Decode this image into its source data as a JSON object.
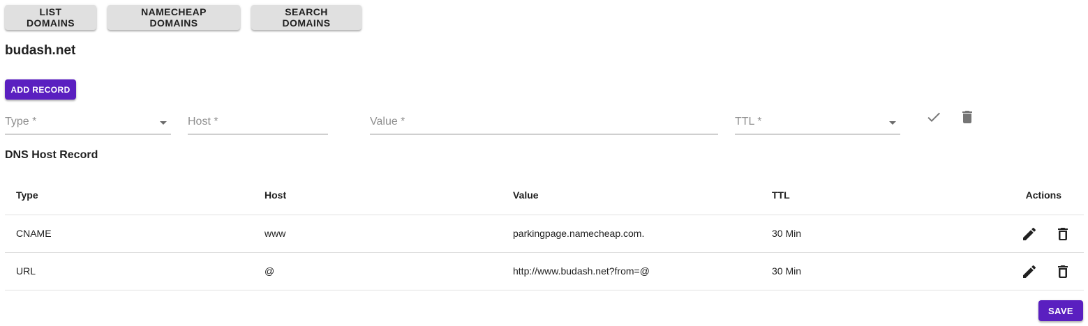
{
  "nav": {
    "list_domains": "LIST DOMAINS",
    "namecheap_domains": "NAMECHEAP DOMAINS",
    "search_domains": "SEARCH DOMAINS"
  },
  "domain": {
    "name": "budash.net"
  },
  "actions": {
    "add_record": "ADD RECORD",
    "save": "SAVE"
  },
  "form": {
    "type_label": "Type *",
    "host_label": "Host *",
    "value_label": "Value *",
    "ttl_label": "TTL *",
    "confirm_icon": "check-icon",
    "delete_icon": "trash-icon"
  },
  "section": {
    "title": "DNS Host Record"
  },
  "table": {
    "headers": {
      "type": "Type",
      "host": "Host",
      "value": "Value",
      "ttl": "TTL",
      "actions": "Actions"
    },
    "rows": [
      {
        "type": "CNAME",
        "host": "www",
        "value": "parkingpage.namecheap.com.",
        "ttl": "30 Min"
      },
      {
        "type": "URL",
        "host": "@",
        "value": "http://www.budash.net?from=@",
        "ttl": "30 Min"
      }
    ]
  },
  "colors": {
    "primary": "#5a1fc0",
    "nav_button_bg": "#e0e0e0",
    "divider": "#e0e0e0",
    "label_gray": "#8f8f8f"
  }
}
